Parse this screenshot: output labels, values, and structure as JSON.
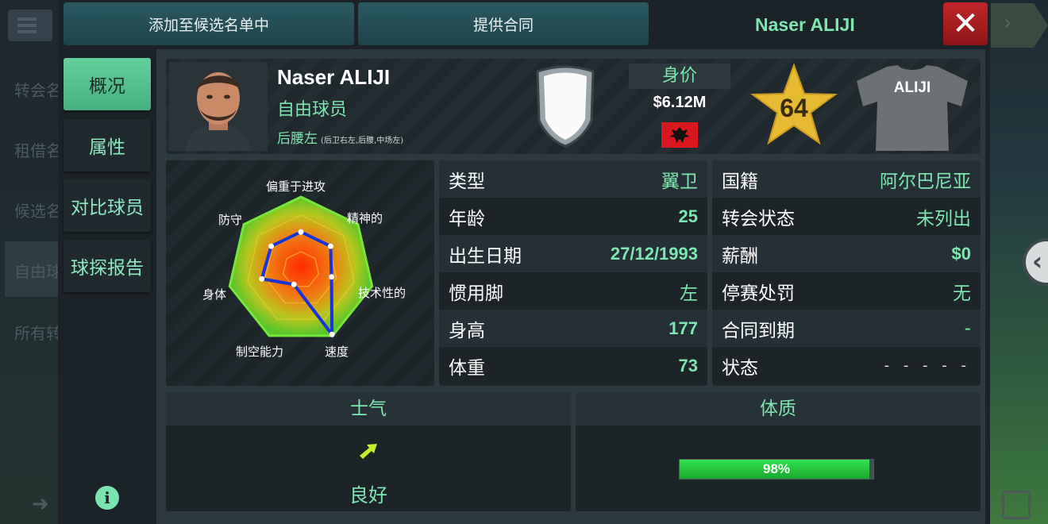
{
  "background": {
    "items": [
      "转会名",
      "租借名",
      "候选名",
      "自由球",
      "所有转"
    ],
    "selected_index": 3
  },
  "toolbar": {
    "shortlist_label": "添加至候选名单中",
    "offer_label": "提供合同",
    "player_title": "Naser ALIJI",
    "close_label": "✕"
  },
  "tabs": [
    {
      "label": "概况",
      "active": true
    },
    {
      "label": "属性",
      "active": false
    },
    {
      "label": "对比球员",
      "active": false
    },
    {
      "label": "球探报告",
      "active": false
    }
  ],
  "player": {
    "name": "Naser ALIJI",
    "status": "自由球员",
    "position": "后腰左",
    "alt_positions": "(后卫右左,后腰,中场左)",
    "value_label": "身价",
    "value": "$6.12M",
    "rating": "64",
    "shirt_name": "ALIJI"
  },
  "radar": {
    "labels": [
      "偏重于进攻",
      "精神的",
      "技术性的",
      "速度",
      "制空能力",
      "身体",
      "防守"
    ]
  },
  "bio": [
    {
      "key": "类型",
      "value": "翼卫"
    },
    {
      "key": "年龄",
      "value": "25"
    },
    {
      "key": "出生日期",
      "value": "27/12/1993"
    },
    {
      "key": "惯用脚",
      "value": "左"
    },
    {
      "key": "身高",
      "value": "177"
    },
    {
      "key": "体重",
      "value": "73"
    }
  ],
  "contract": [
    {
      "key": "国籍",
      "value": "阿尔巴尼亚"
    },
    {
      "key": "转会状态",
      "value": "未列出"
    },
    {
      "key": "薪酬",
      "value": "$0"
    },
    {
      "key": "停赛处罚",
      "value": "无"
    },
    {
      "key": "合同到期",
      "value": "-"
    },
    {
      "key": "状态",
      "value": "- - - - -"
    }
  ],
  "morale": {
    "title": "士气",
    "value": "良好"
  },
  "fitness": {
    "title": "体质",
    "percent": 98,
    "label": "98%"
  },
  "colors": {
    "accent": "#7ee6b0",
    "close": "#c0262a",
    "star": "#e6ba32"
  }
}
